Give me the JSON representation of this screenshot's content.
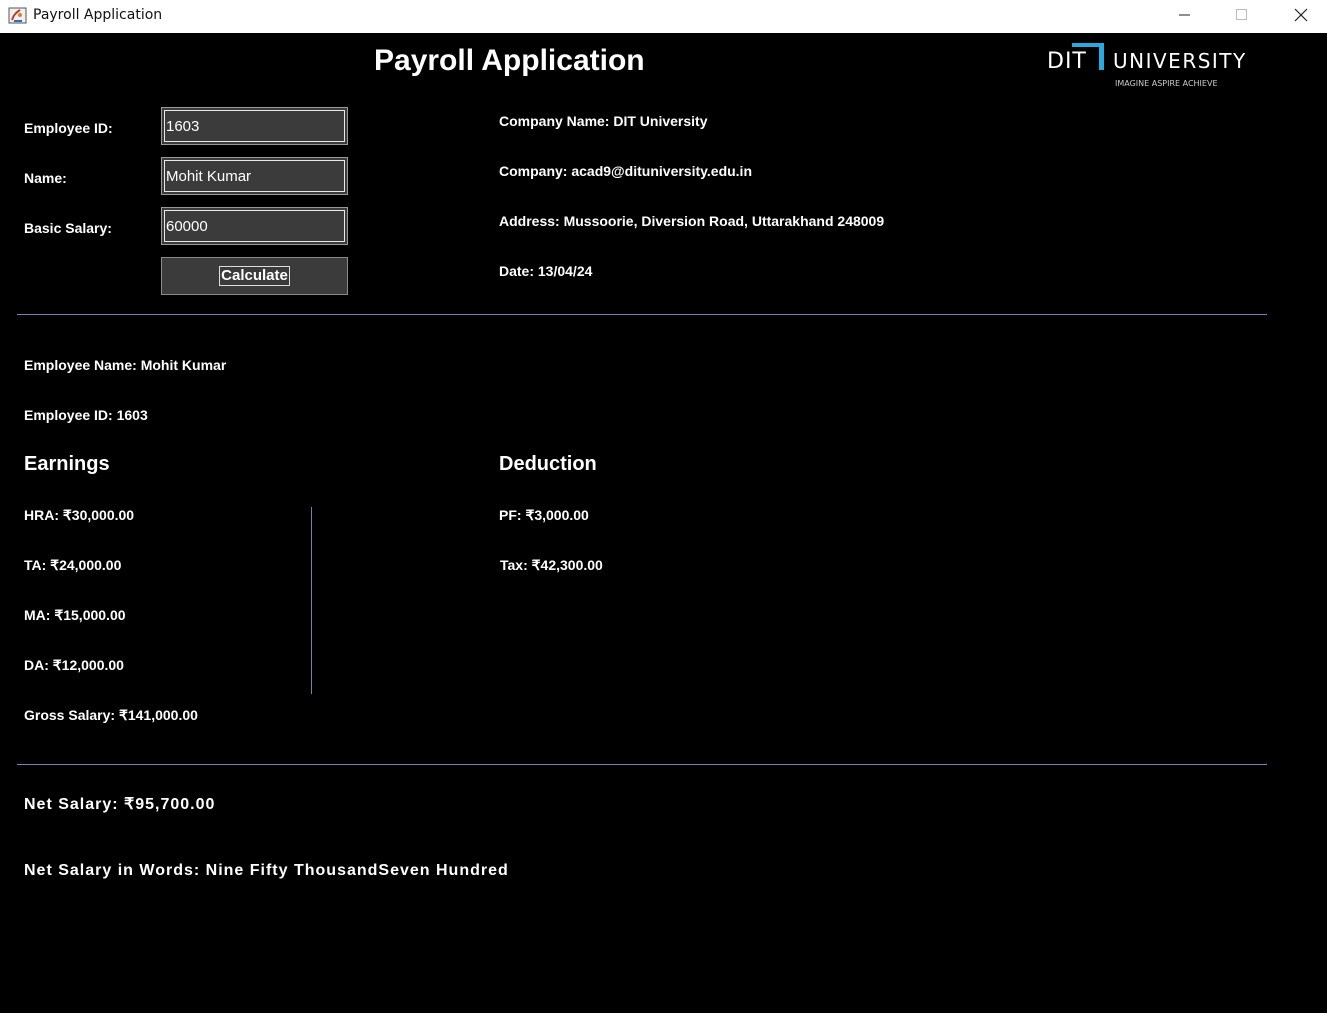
{
  "window": {
    "title": "Payroll Application"
  },
  "header": {
    "title": "Payroll Application",
    "logo": {
      "text": "DIT UNIVERSITY",
      "tagline": "IMAGINE · ASPIRE · ACHIEVE",
      "accent": "#2aa8e0"
    }
  },
  "form": {
    "employee_id_label": "Employee ID:",
    "employee_id_value": "1603",
    "name_label": "Name:",
    "name_value": "Mohit Kumar",
    "basic_salary_label": "Basic Salary:",
    "basic_salary_value": "60000",
    "calculate_label": "Calculate"
  },
  "company": {
    "name": "Company Name: DIT University",
    "email": "Company: acad9@dituniversity.edu.in",
    "address": "Address: Mussoorie, Diversion Road, Uttarakhand 248009",
    "date": "Date: 13/04/24"
  },
  "employee": {
    "name": "Employee Name:  Mohit Kumar",
    "id": "Employee ID:  1603"
  },
  "earnings": {
    "title": "Earnings",
    "hra": "HRA: ₹30,000.00",
    "ta": "TA: ₹24,000.00",
    "ma": "MA: ₹15,000.00",
    "da": "DA: ₹12,000.00",
    "gross": "Gross Salary: ₹141,000.00"
  },
  "deduction": {
    "title": "Deduction",
    "pf": "PF: ₹3,000.00",
    "tax": "Tax: ₹42,300.00"
  },
  "net": {
    "salary": "Net Salary: ₹95,700.00",
    "words": "Net Salary in Words: Nine Fifty ThousandSeven Hundred"
  }
}
